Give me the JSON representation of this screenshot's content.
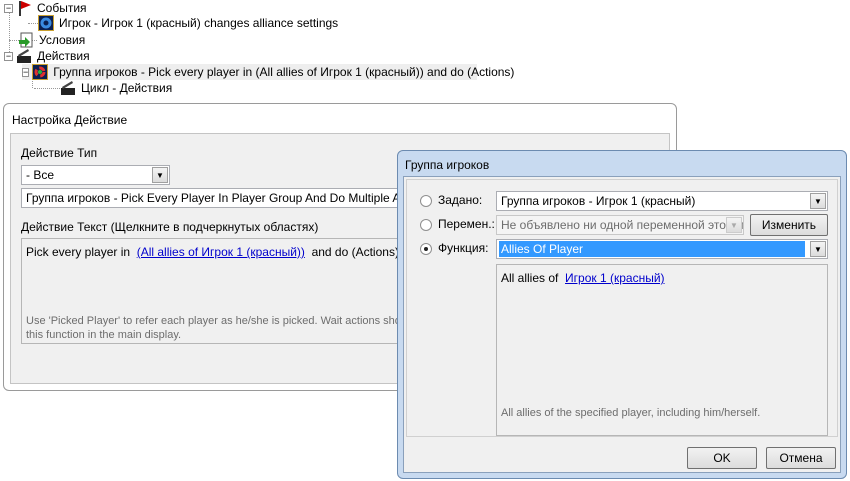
{
  "tree": {
    "events": "События",
    "event_item": "Игрок - Игрок 1 (красный) changes alliance settings",
    "conditions": "Условия",
    "actions": "Действия",
    "action_item": "Группа игроков - Pick every player in (All allies of Игрок 1 (красный)) and do (Actions)",
    "loop_item": "Цикл - Действия"
  },
  "action_dialog": {
    "title": "Настройка Действие",
    "type_label": "Действие Тип",
    "type_value": "- Все",
    "action_value": "Группа игроков - Pick Every Player In Player Group And Do Multiple Actions",
    "text_label": "Действие Текст (Щелкните в подчеркнутых областях)",
    "text_prefix": "Pick every player in",
    "text_link": "(All allies of Игрок 1 (красный))",
    "text_suffix": "and do (Actions)",
    "hint_line1": "Use 'Picked Player' to refer each player as he/she is picked.  Wait actions shou",
    "hint_line2": "this function in the main display."
  },
  "group_dialog": {
    "title": "Группа игроков",
    "preset_label": "Задано:",
    "preset_value": "Группа игроков - Игрок 1 (красный)",
    "variable_label": "Перемен.:",
    "variable_value": "Не объявлено ни одной переменной этого ти",
    "edit_button": "Изменить",
    "function_label": "Функция:",
    "function_value": "Allies Of Player",
    "func_prefix": "All allies of",
    "func_link": "Игрок 1 (красный)",
    "description": "All allies of the specified player, including him/herself.",
    "ok": "OK",
    "cancel": "Отмена",
    "selected": "function"
  }
}
